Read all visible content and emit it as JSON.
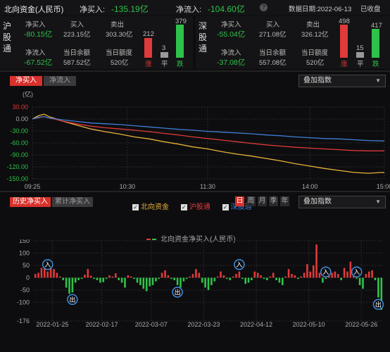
{
  "header": {
    "title": "北向资金(人民币)",
    "net_buy_label": "净买入:",
    "net_buy_value": "-135.19亿",
    "net_inflow_label": "净流入:",
    "net_inflow_value": "-104.60亿",
    "help_icon": "question-icon",
    "date_label": "数据日期:2022-06-13",
    "status": "已收盘"
  },
  "hgt": {
    "name": "沪股通",
    "net_buy_label": "净买入",
    "net_buy_value": "-80.15亿",
    "buy_label": "买入",
    "buy_value": "223.15亿",
    "sell_label": "卖出",
    "sell_value": "303.30亿",
    "net_inflow_label": "净流入",
    "net_inflow_value": "-67.52亿",
    "balance_label": "当日余额",
    "balance_value": "587.52亿",
    "quota_label": "当日额度",
    "quota_value": "520亿",
    "up_count": "212",
    "flat_count": "3",
    "down_count": "379",
    "up_label": "涨",
    "flat_label": "平",
    "down_label": "跌"
  },
  "sgt": {
    "name": "深股通",
    "net_buy_label": "净买入",
    "net_buy_value": "-55.04亿",
    "buy_label": "买入",
    "buy_value": "271.08亿",
    "sell_label": "卖出",
    "sell_value": "326.12亿",
    "net_inflow_label": "净流入",
    "net_inflow_value": "-37.08亿",
    "balance_label": "当日余额",
    "balance_value": "557.08亿",
    "quota_label": "当日额度",
    "quota_value": "520亿",
    "up_count": "498",
    "flat_count": "15",
    "down_count": "417",
    "up_label": "涨",
    "flat_label": "平",
    "down_label": "跌"
  },
  "intraday": {
    "tab_active": "净买入",
    "tab_inactive": "净流入",
    "overlay_dropdown": "叠加指数",
    "unit": "(亿)",
    "legend": [
      {
        "label": "北向资金",
        "color": "#e8b23a"
      },
      {
        "label": "沪股通",
        "color": "#e03a3a"
      },
      {
        "label": "深股通",
        "color": "#3f7fd6"
      }
    ],
    "chart_data": {
      "type": "line",
      "x_ticks": [
        "09:25",
        "10:30",
        "11:30",
        "14:00",
        "15:00"
      ],
      "y_ticks": [
        30,
        0,
        -30,
        -60,
        -90,
        -120,
        -150
      ],
      "ylim": [
        -150,
        30
      ],
      "series": [
        {
          "name": "北向资金",
          "color": "#e8b23a",
          "x": [
            0,
            4,
            8,
            12,
            15,
            20,
            30,
            40,
            50,
            60,
            70,
            80,
            90,
            100,
            110,
            120,
            130,
            140,
            150,
            160,
            170,
            180,
            190,
            200,
            210,
            220,
            230,
            240,
            241
          ],
          "values": [
            0,
            8,
            12,
            5,
            2,
            -5,
            -15,
            -25,
            -32,
            -38,
            -45,
            -50,
            -57,
            -63,
            -70,
            -75,
            -82,
            -88,
            -93,
            -99,
            -105,
            -112,
            -118,
            -124,
            -129,
            -134,
            -136,
            -134,
            -135
          ]
        },
        {
          "name": "沪股通",
          "color": "#e03a3a",
          "x": [
            0,
            4,
            8,
            12,
            15,
            20,
            30,
            40,
            50,
            60,
            70,
            80,
            90,
            100,
            110,
            120,
            130,
            140,
            150,
            160,
            170,
            180,
            190,
            200,
            210,
            220,
            230,
            240,
            241
          ],
          "values": [
            0,
            3,
            6,
            2,
            0,
            -5,
            -12,
            -18,
            -22,
            -25,
            -28,
            -32,
            -36,
            -40,
            -45,
            -49,
            -53,
            -57,
            -61,
            -65,
            -68,
            -71,
            -73,
            -75,
            -77,
            -79,
            -80,
            -80,
            -80
          ]
        },
        {
          "name": "深股通",
          "color": "#3f7fd6",
          "x": [
            0,
            4,
            8,
            12,
            15,
            20,
            30,
            40,
            50,
            60,
            70,
            80,
            90,
            100,
            110,
            120,
            130,
            140,
            150,
            160,
            170,
            180,
            190,
            200,
            210,
            220,
            230,
            240,
            241
          ],
          "values": [
            0,
            4,
            6,
            2,
            1,
            -2,
            -6,
            -10,
            -12,
            -14,
            -17,
            -20,
            -23,
            -26,
            -28,
            -31,
            -33,
            -35,
            -37,
            -40,
            -42,
            -45,
            -47,
            -49,
            -50,
            -52,
            -54,
            -55,
            -55
          ]
        }
      ]
    }
  },
  "history": {
    "tab_active": "历史净买入",
    "tab_inactive": "累计净买入",
    "periods": [
      "日",
      "周",
      "月",
      "季",
      "年"
    ],
    "overlay_dropdown": "叠加指数",
    "legend_label": "北向资金净买入(人民币)",
    "markers": {
      "in_label": "入",
      "out_label": "出"
    },
    "chart_data": {
      "type": "bar",
      "y_ticks": [
        150,
        100,
        50,
        0,
        -50,
        -100,
        -176
      ],
      "ylim": [
        -176,
        150
      ],
      "x_ticks": [
        "2022-01-25",
        "2022-02-17",
        "2022-03-07",
        "2022-03-23",
        "2022-04-12",
        "2022-05-10",
        "2022-05-26"
      ],
      "series": [
        {
          "name": "北向资金净买入",
          "values": [
            15,
            20,
            40,
            45,
            25,
            65,
            35,
            20,
            5,
            -10,
            -40,
            -65,
            -60,
            -20,
            -10,
            -5,
            12,
            35,
            8,
            -5,
            -10,
            -20,
            -18,
            -5,
            10,
            5,
            18,
            -10,
            -20,
            -40,
            10,
            5,
            -5,
            -20,
            -30,
            -45,
            -55,
            -35,
            -30,
            -15,
            -5,
            20,
            30,
            10,
            -5,
            -10,
            -30,
            -40,
            -15,
            -5,
            5,
            15,
            35,
            20,
            -20,
            -40,
            -50,
            -30,
            -15,
            5,
            25,
            10,
            -5,
            -10,
            5,
            15,
            25,
            -5,
            -25,
            -20,
            -10,
            25,
            20,
            10,
            -5,
            -10,
            5,
            20,
            -10,
            -20,
            -30,
            5,
            35,
            15,
            10,
            -5,
            5,
            20,
            55,
            25,
            50,
            135,
            20,
            -20,
            -5,
            40,
            20,
            25,
            15,
            -10,
            40,
            25,
            65,
            10,
            -5,
            -30,
            -45,
            15,
            25,
            30,
            -10,
            -80,
            -130
          ]
        }
      ]
    }
  }
}
